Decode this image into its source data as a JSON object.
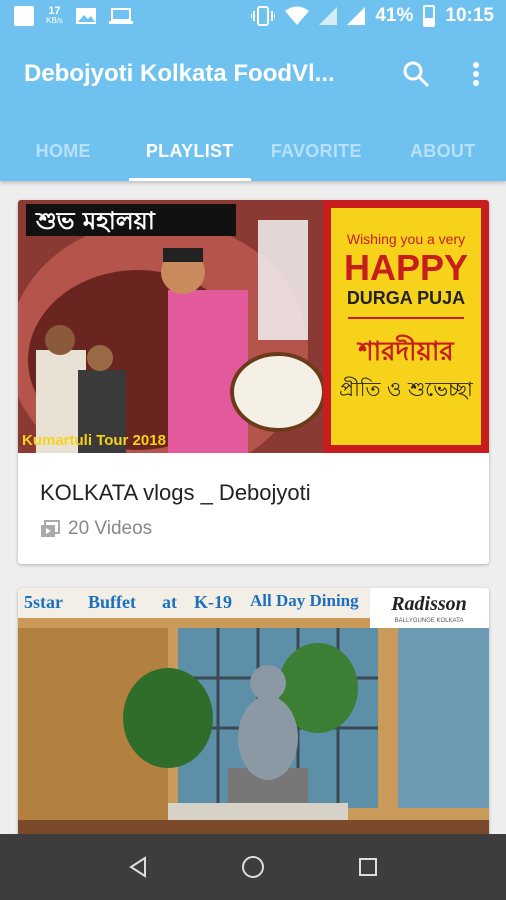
{
  "status_bar": {
    "speed_value": "17",
    "speed_unit": "KB/s",
    "battery": "41%",
    "time": "10:15"
  },
  "app_bar": {
    "title": "Debojyoti Kolkata FoodVl...",
    "tabs": [
      {
        "label": "HOME"
      },
      {
        "label": "PLAYLIST"
      },
      {
        "label": "FAVORITE"
      },
      {
        "label": "ABOUT"
      }
    ],
    "active_tab": "PLAYLIST"
  },
  "playlists": [
    {
      "title": "KOLKATA vlogs _ Debojyoti",
      "count": "20 Videos",
      "thumb_text": {
        "top_left": "শুভ মহালয়া",
        "wish_line": "Wishing you a very",
        "happy": "HAPPY",
        "durga": "DURGA PUJA",
        "bengali_1": "শারদীয়ার",
        "bengali_2": "প্রীতি ও শুভেচ্ছা",
        "tour": "Kumartuli Tour 2018"
      }
    },
    {
      "thumb_text": {
        "w1": "5star",
        "w2": "Buffet",
        "w3": "at",
        "w4": "K-19",
        "w5": "All Day Dining",
        "brand": "Radisson",
        "brand_sub": "BALLYGUNGE KOLKATA"
      }
    }
  ],
  "colors": {
    "primary": "#6fc2f0",
    "tab_inactive": "#b8e0f7",
    "navbar": "#3d3d3d"
  }
}
